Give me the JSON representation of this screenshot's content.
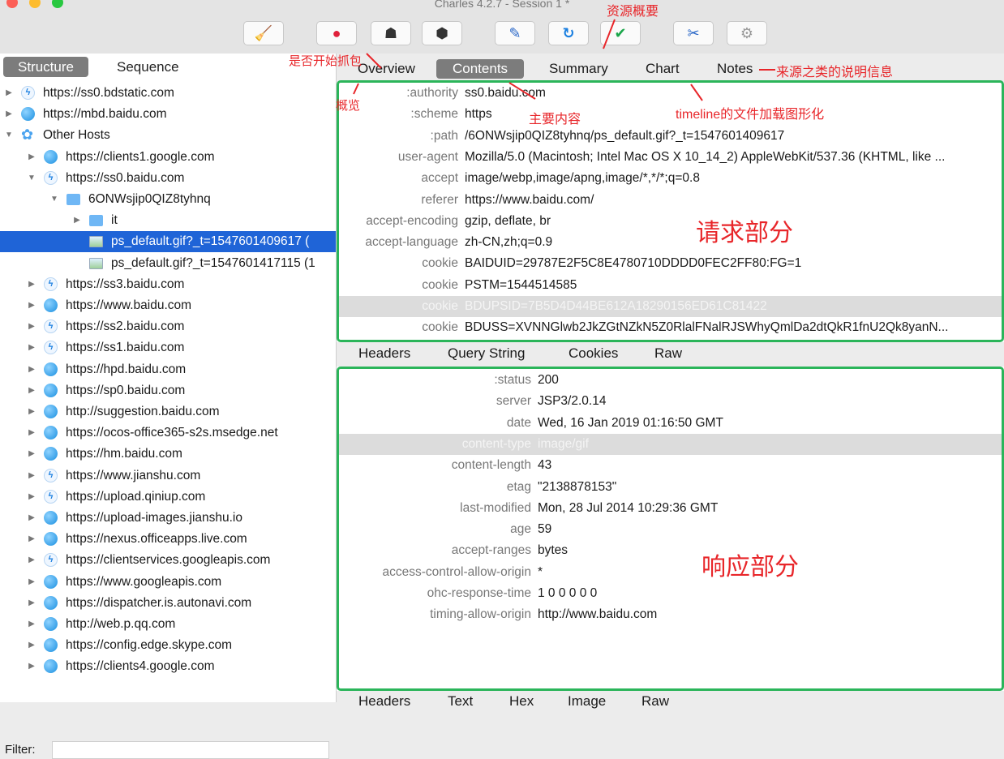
{
  "window": {
    "title": "Charles 4.2.7 - Session 1 *"
  },
  "toolbar": {
    "buttons": [
      {
        "icon": "broom-icon",
        "glyph": "🧹"
      },
      {
        "icon": "record-icon",
        "glyph": "●"
      },
      {
        "icon": "throttle-turtle-icon",
        "glyph": "☗"
      },
      {
        "icon": "breakpoint-stop-icon",
        "glyph": "⬢"
      },
      {
        "icon": "compose-pen-icon",
        "glyph": "✎"
      },
      {
        "icon": "repeat-icon",
        "glyph": "↻"
      },
      {
        "icon": "validate-check-icon",
        "glyph": "✔"
      },
      {
        "icon": "tools-icon",
        "glyph": "✂"
      },
      {
        "icon": "settings-gear-icon",
        "glyph": "⚙"
      }
    ]
  },
  "left": {
    "structure_label": "Structure",
    "sequence_label": "Sequence",
    "filter_label": "Filter:",
    "tree": [
      {
        "text": "https://ss0.bdstatic.com",
        "icon": "bolt",
        "depth": 0,
        "arrow": "▶"
      },
      {
        "text": "https://mbd.baidu.com",
        "icon": "globe",
        "depth": 0,
        "arrow": "▶"
      },
      {
        "text": "Other Hosts",
        "icon": "cloud",
        "depth": 0,
        "arrow": "▼"
      },
      {
        "text": "https://clients1.google.com",
        "icon": "globe",
        "depth": 1,
        "arrow": "▶"
      },
      {
        "text": "https://ss0.baidu.com",
        "icon": "bolt",
        "depth": 1,
        "arrow": "▼"
      },
      {
        "text": "6ONWsjip0QIZ8tyhnq",
        "icon": "folder",
        "depth": 2,
        "arrow": "▼"
      },
      {
        "text": "it",
        "icon": "folder",
        "depth": 3,
        "arrow": "▶"
      },
      {
        "text": "ps_default.gif?_t=1547601409617 (",
        "icon": "img",
        "depth": 3,
        "arrow": "",
        "selected": true
      },
      {
        "text": "ps_default.gif?_t=1547601417115 (1",
        "icon": "img",
        "depth": 3,
        "arrow": ""
      },
      {
        "text": "https://ss3.baidu.com",
        "icon": "bolt",
        "depth": 1,
        "arrow": "▶"
      },
      {
        "text": "https://www.baidu.com",
        "icon": "globe",
        "depth": 1,
        "arrow": "▶"
      },
      {
        "text": "https://ss2.baidu.com",
        "icon": "bolt",
        "depth": 1,
        "arrow": "▶"
      },
      {
        "text": "https://ss1.baidu.com",
        "icon": "bolt",
        "depth": 1,
        "arrow": "▶"
      },
      {
        "text": "https://hpd.baidu.com",
        "icon": "globe",
        "depth": 1,
        "arrow": "▶"
      },
      {
        "text": "https://sp0.baidu.com",
        "icon": "globe",
        "depth": 1,
        "arrow": "▶"
      },
      {
        "text": "http://suggestion.baidu.com",
        "icon": "globe",
        "depth": 1,
        "arrow": "▶"
      },
      {
        "text": "https://ocos-office365-s2s.msedge.net",
        "icon": "globe",
        "depth": 1,
        "arrow": "▶"
      },
      {
        "text": "https://hm.baidu.com",
        "icon": "globe",
        "depth": 1,
        "arrow": "▶"
      },
      {
        "text": "https://www.jianshu.com",
        "icon": "bolt",
        "depth": 1,
        "arrow": "▶"
      },
      {
        "text": "https://upload.qiniup.com",
        "icon": "bolt",
        "depth": 1,
        "arrow": "▶"
      },
      {
        "text": "https://upload-images.jianshu.io",
        "icon": "globe",
        "depth": 1,
        "arrow": "▶"
      },
      {
        "text": "https://nexus.officeapps.live.com",
        "icon": "globe",
        "depth": 1,
        "arrow": "▶"
      },
      {
        "text": "https://clientservices.googleapis.com",
        "icon": "bolt",
        "depth": 1,
        "arrow": "▶"
      },
      {
        "text": "https://www.googleapis.com",
        "icon": "globe",
        "depth": 1,
        "arrow": "▶"
      },
      {
        "text": "https://dispatcher.is.autonavi.com",
        "icon": "globe",
        "depth": 1,
        "arrow": "▶"
      },
      {
        "text": "http://web.p.qq.com",
        "icon": "globe",
        "depth": 1,
        "arrow": "▶"
      },
      {
        "text": "https://config.edge.skype.com",
        "icon": "globe",
        "depth": 1,
        "arrow": "▶"
      },
      {
        "text": "https://clients4.google.com",
        "icon": "globe",
        "depth": 1,
        "arrow": "▶"
      }
    ]
  },
  "right": {
    "tabs": [
      "Overview",
      "Contents",
      "Summary",
      "Chart",
      "Notes"
    ],
    "active_tab": "Contents",
    "request_headers": [
      {
        "k": ":authority",
        "v": "ss0.baidu.com"
      },
      {
        "k": ":scheme",
        "v": "https"
      },
      {
        "k": ":path",
        "v": "/6ONWsjip0QIZ8tyhnq/ps_default.gif?_t=1547601409617"
      },
      {
        "k": "user-agent",
        "v": "Mozilla/5.0 (Macintosh; Intel Mac OS X 10_14_2) AppleWebKit/537.36 (KHTML, like ..."
      },
      {
        "k": "accept",
        "v": "image/webp,image/apng,image/*,*/*;q=0.8"
      },
      {
        "k": "referer",
        "v": "https://www.baidu.com/"
      },
      {
        "k": "accept-encoding",
        "v": "gzip, deflate, br"
      },
      {
        "k": "accept-language",
        "v": "zh-CN,zh;q=0.9"
      },
      {
        "k": "cookie",
        "v": "BAIDUID=29787E2F5C8E4780710DDDD0FEC2FF80:FG=1"
      },
      {
        "k": "cookie",
        "v": "PSTM=1544514585"
      },
      {
        "k": "cookie",
        "v": "BDUPSID=7B5D4D44BE612A18290156ED61C81422",
        "highlight": true
      },
      {
        "k": "cookie",
        "v": "BDUSS=XVNNGlwb2JkZGtNZkN5Z0RlalFNalRJSWhyQmlDa2dtQkR1fnU2Qk8yanN..."
      }
    ],
    "sub_tabs": [
      "Headers",
      "Query String",
      "Cookies",
      "Raw"
    ],
    "response_headers": [
      {
        "k": ":status",
        "v": "200"
      },
      {
        "k": "server",
        "v": "JSP3/2.0.14"
      },
      {
        "k": "date",
        "v": "Wed, 16 Jan 2019 01:16:50 GMT"
      },
      {
        "k": "content-type",
        "v": "image/gif",
        "highlight": true
      },
      {
        "k": "content-length",
        "v": "43"
      },
      {
        "k": "etag",
        "v": "\"2138878153\""
      },
      {
        "k": "last-modified",
        "v": "Mon, 28 Jul 2014 10:29:36 GMT"
      },
      {
        "k": "age",
        "v": "59"
      },
      {
        "k": "accept-ranges",
        "v": "bytes"
      },
      {
        "k": "access-control-allow-origin",
        "v": "*"
      },
      {
        "k": "ohc-response-time",
        "v": "1 0 0 0 0 0"
      },
      {
        "k": "timing-allow-origin",
        "v": "http://www.baidu.com"
      }
    ],
    "bottom_tabs": [
      "Headers",
      "Text",
      "Hex",
      "Image",
      "Raw"
    ]
  },
  "annotations": {
    "resource_overview": "资源概要",
    "start_capture": "是否开始抓包",
    "overview": "概览",
    "main_content": "主要内容",
    "timeline": "timeline的文件加载图形化",
    "notes_desc": "来源之类的说明信息",
    "request_part": "请求部分",
    "response_part": "响应部分"
  },
  "colors": {
    "selection": "#1f64d7",
    "annotation": "#e8262a",
    "highlight_box": "#2bb55a"
  }
}
